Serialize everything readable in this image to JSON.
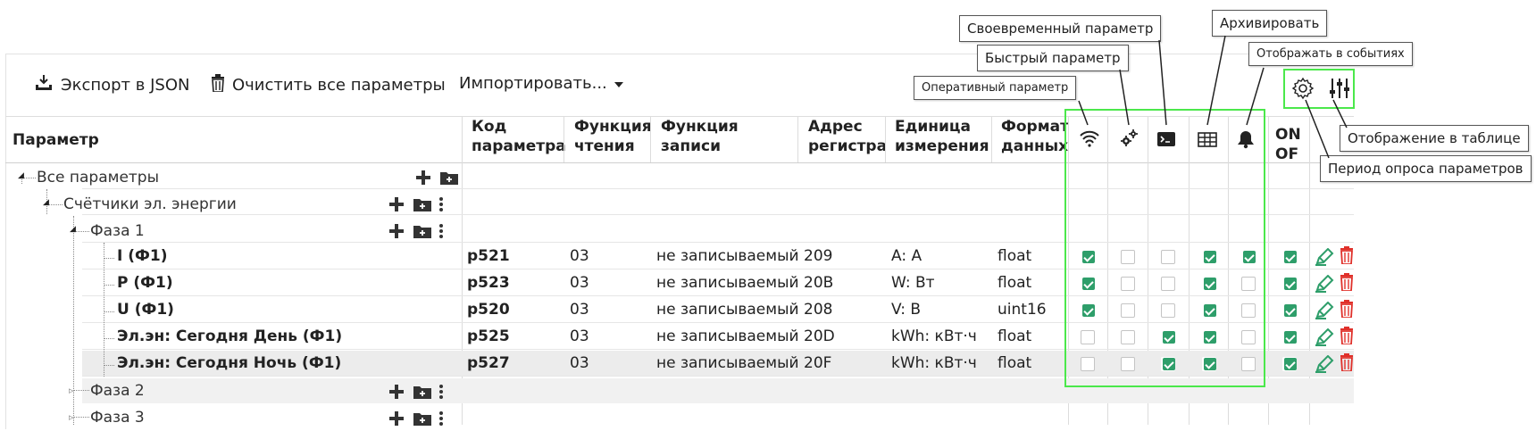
{
  "toolbar": {
    "export_label": "Экспорт в JSON",
    "clear_label": "Очистить все параметры",
    "import_label": "Импортировать..."
  },
  "callouts": {
    "timely": "Своевременный параметр",
    "fast": "Быстрый параметр",
    "operative": "Оперативный параметр",
    "archive": "Архивировать",
    "events": "Отображать в событиях",
    "table_display": "Отображение в таблице",
    "poll_period": "Период опроса параметров"
  },
  "columns": {
    "param": "Параметр",
    "code_1": "Код",
    "code_2": "параметра",
    "read_1": "Функция",
    "read_2": "чтения",
    "write_1": "Функция",
    "write_2": "записи",
    "addr_1": "Адрес",
    "addr_2": "регистра",
    "unit_1": "Единица",
    "unit_2": "измерения",
    "fmt_1": "Формат",
    "fmt_2": "данных",
    "onoff_1": "ON",
    "onoff_2": "OF"
  },
  "tree": {
    "all": "Все параметры",
    "meters": "Счётчики эл. энергии",
    "phase1": "Фаза 1",
    "phase2": "Фаза 2",
    "phase3": "Фаза 3"
  },
  "rows": [
    {
      "name": "I (Ф1)",
      "code": "p521",
      "read": "03",
      "write": "не записываемый",
      "addr": "209",
      "unit": "A: A",
      "fmt": "float",
      "flags": [
        true,
        false,
        false,
        true,
        true,
        true
      ]
    },
    {
      "name": "P (Ф1)",
      "code": "p523",
      "read": "03",
      "write": "не записываемый",
      "addr": "20B",
      "unit": "W: Вт",
      "fmt": "float",
      "flags": [
        true,
        false,
        false,
        true,
        false,
        true
      ]
    },
    {
      "name": "U (Ф1)",
      "code": "p520",
      "read": "03",
      "write": "не записываемый",
      "addr": "208",
      "unit": "V: В",
      "fmt": "uint16",
      "flags": [
        true,
        false,
        false,
        true,
        false,
        true
      ]
    },
    {
      "name": "Эл.эн: Сегодня День (Ф1)",
      "code": "p525",
      "read": "03",
      "write": "не записываемый",
      "addr": "20D",
      "unit": "kWh: кВт·ч",
      "fmt": "float",
      "flags": [
        false,
        false,
        true,
        true,
        false,
        true
      ]
    },
    {
      "name": "Эл.эн: Сегодня Ночь (Ф1)",
      "code": "p527",
      "read": "03",
      "write": "не записываемый",
      "addr": "20F",
      "unit": "kWh: кВт·ч",
      "fmt": "float",
      "flags": [
        false,
        false,
        true,
        true,
        false,
        true
      ]
    }
  ],
  "colors": {
    "accent": "#2e9e6a",
    "highlight": "#4be84b",
    "delete": "#e0302a"
  }
}
